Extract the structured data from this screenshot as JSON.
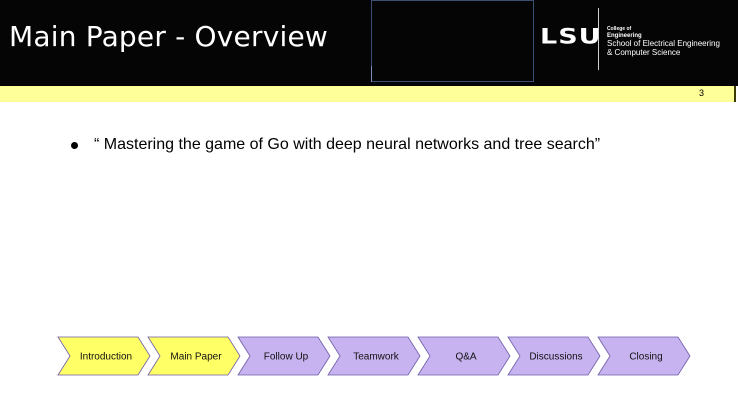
{
  "header": {
    "title": "Main Paper - Overview",
    "logo_text": "LSU",
    "college_small": "College of",
    "college_engineering": "Engineering",
    "school_line1": "School of Electrical Engineering",
    "school_line2": "& Computer Science"
  },
  "slide": {
    "number": "3"
  },
  "content": {
    "bullets": [
      "“ Mastering the game of Go with deep neural networks and tree search”"
    ]
  },
  "nav": {
    "items": [
      {
        "label": "Introduction",
        "highlighted": true
      },
      {
        "label": "Main Paper",
        "highlighted": true
      },
      {
        "label": "Follow Up",
        "highlighted": false
      },
      {
        "label": "Teamwork",
        "highlighted": false
      },
      {
        "label": "Q&A",
        "highlighted": false
      },
      {
        "label": "Discussions",
        "highlighted": false
      },
      {
        "label": "Closing",
        "highlighted": false
      }
    ]
  },
  "colors": {
    "header_background": "#050505",
    "accent_bar": "#ffff99",
    "nav_highlight_fill": "#ffff66",
    "nav_default_fill": "#c7b3f0",
    "nav_stroke": "#6f5ba6"
  }
}
